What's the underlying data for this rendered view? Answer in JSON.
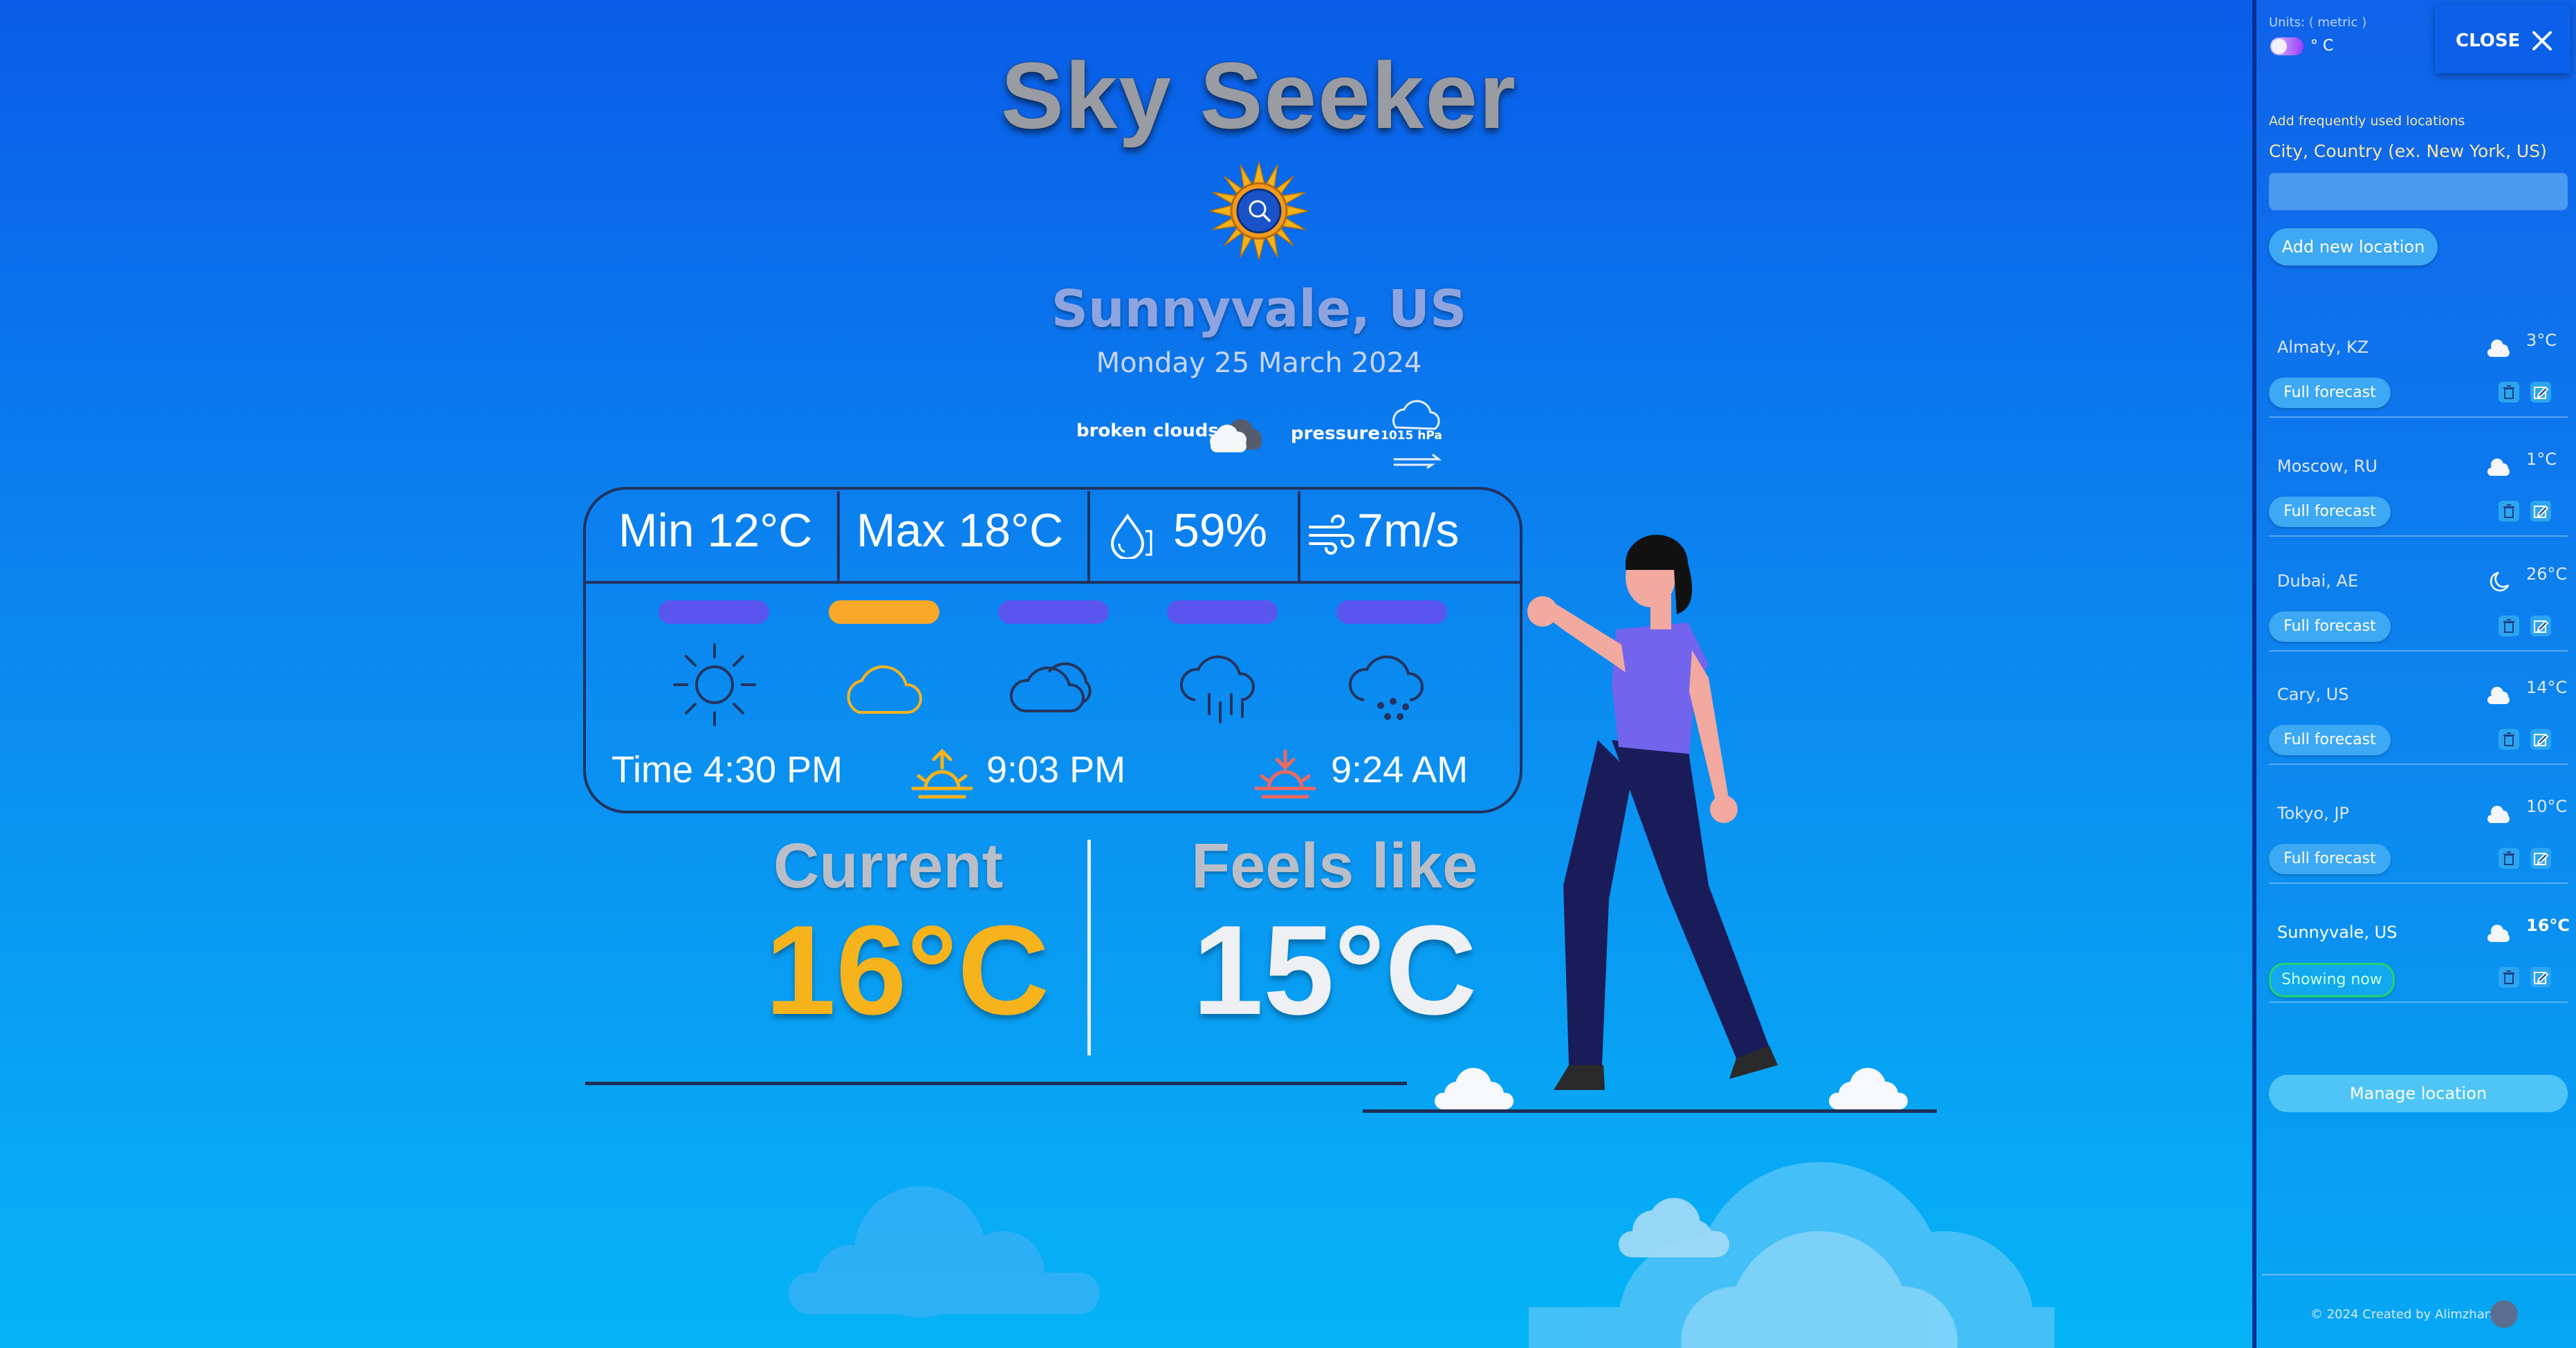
{
  "app": {
    "title": "Sky Seeker",
    "logo_icon": "sun-search-icon"
  },
  "location": {
    "city": "Sunnyvale, US",
    "date": "Monday 25 March 2024",
    "description": "broken clouds",
    "pressure_label": "pressure",
    "pressure_value": "1015 hPa"
  },
  "stats": {
    "min": "Min 12°C",
    "max": "Max 18°C",
    "humidity": "59%",
    "wind": "7m/s"
  },
  "conditions": {
    "icons": [
      "sun-icon",
      "cloud-icon",
      "cloudy-icon",
      "rain-icon",
      "snow-icon"
    ],
    "active_index": 1
  },
  "times": {
    "time": "Time 4:30 PM",
    "sunrise": "9:03 PM",
    "sunset": "9:24 AM"
  },
  "current": {
    "label": "Current",
    "value": "16°C",
    "color": "#f7b31c"
  },
  "feels": {
    "label": "Feels like",
    "value": "15°C",
    "color": "#eef0f4"
  },
  "sidebar": {
    "units_label": "Units: ( metric )",
    "units_value": "° C",
    "close_label": "CLOSE",
    "add_heading": "Add frequently used locations",
    "input_label": "City, Country (ex. New York, US)",
    "input_value": "",
    "add_button": "Add new location",
    "manage_button": "Manage location",
    "footer": "© 2024 Created by Alimzhan",
    "locations": [
      {
        "name": "Almaty, KZ",
        "temp": "3°C",
        "icon": "cloud-icon",
        "button": "Full forecast"
      },
      {
        "name": "Moscow, RU",
        "temp": "1°C",
        "icon": "cloud-icon",
        "button": "Full forecast"
      },
      {
        "name": "Dubai, AE",
        "temp": "26°C",
        "icon": "moon-icon",
        "button": "Full forecast"
      },
      {
        "name": "Cary, US",
        "temp": "14°C",
        "icon": "cloud-icon",
        "button": "Full forecast"
      },
      {
        "name": "Tokyo, JP",
        "temp": "10°C",
        "icon": "cloud-icon",
        "button": "Full forecast"
      },
      {
        "name": "Sunnyvale, US",
        "temp": "16°C",
        "icon": "cloud-icon",
        "button": "Showing now"
      }
    ]
  }
}
